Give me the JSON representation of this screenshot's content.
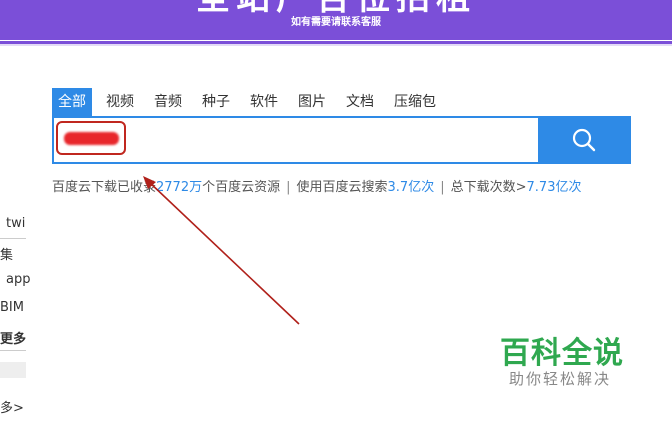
{
  "banner": {
    "title": "全站广告位招租",
    "subtitle": "如有需要请联系客服"
  },
  "tabs": [
    {
      "label": "全部",
      "active": true
    },
    {
      "label": "视频",
      "active": false
    },
    {
      "label": "音频",
      "active": false
    },
    {
      "label": "种子",
      "active": false
    },
    {
      "label": "软件",
      "active": false
    },
    {
      "label": "图片",
      "active": false
    },
    {
      "label": "文档",
      "active": false
    },
    {
      "label": "压缩包",
      "active": false
    }
  ],
  "search": {
    "value": "",
    "button_icon": "search-icon",
    "redacted": true
  },
  "stats": {
    "part1": "百度云下载已收录",
    "resources_count": "2772万",
    "part2": "个百度云资源",
    "sep": "|",
    "part3": "使用百度云搜索",
    "search_count": "3.7亿次",
    "part4": "总下载次数>",
    "download_count": "7.73亿次"
  },
  "left_sidebar": [
    "twi",
    "集",
    "app",
    "BIM",
    "更多",
    "多>"
  ],
  "watermark": {
    "title": "百科全说",
    "subtitle": "助你轻松解决"
  },
  "colors": {
    "banner": "#7b4fd8",
    "accent": "#2e8ae6",
    "annotation": "#b0201a",
    "watermark": "#2fa84f"
  }
}
